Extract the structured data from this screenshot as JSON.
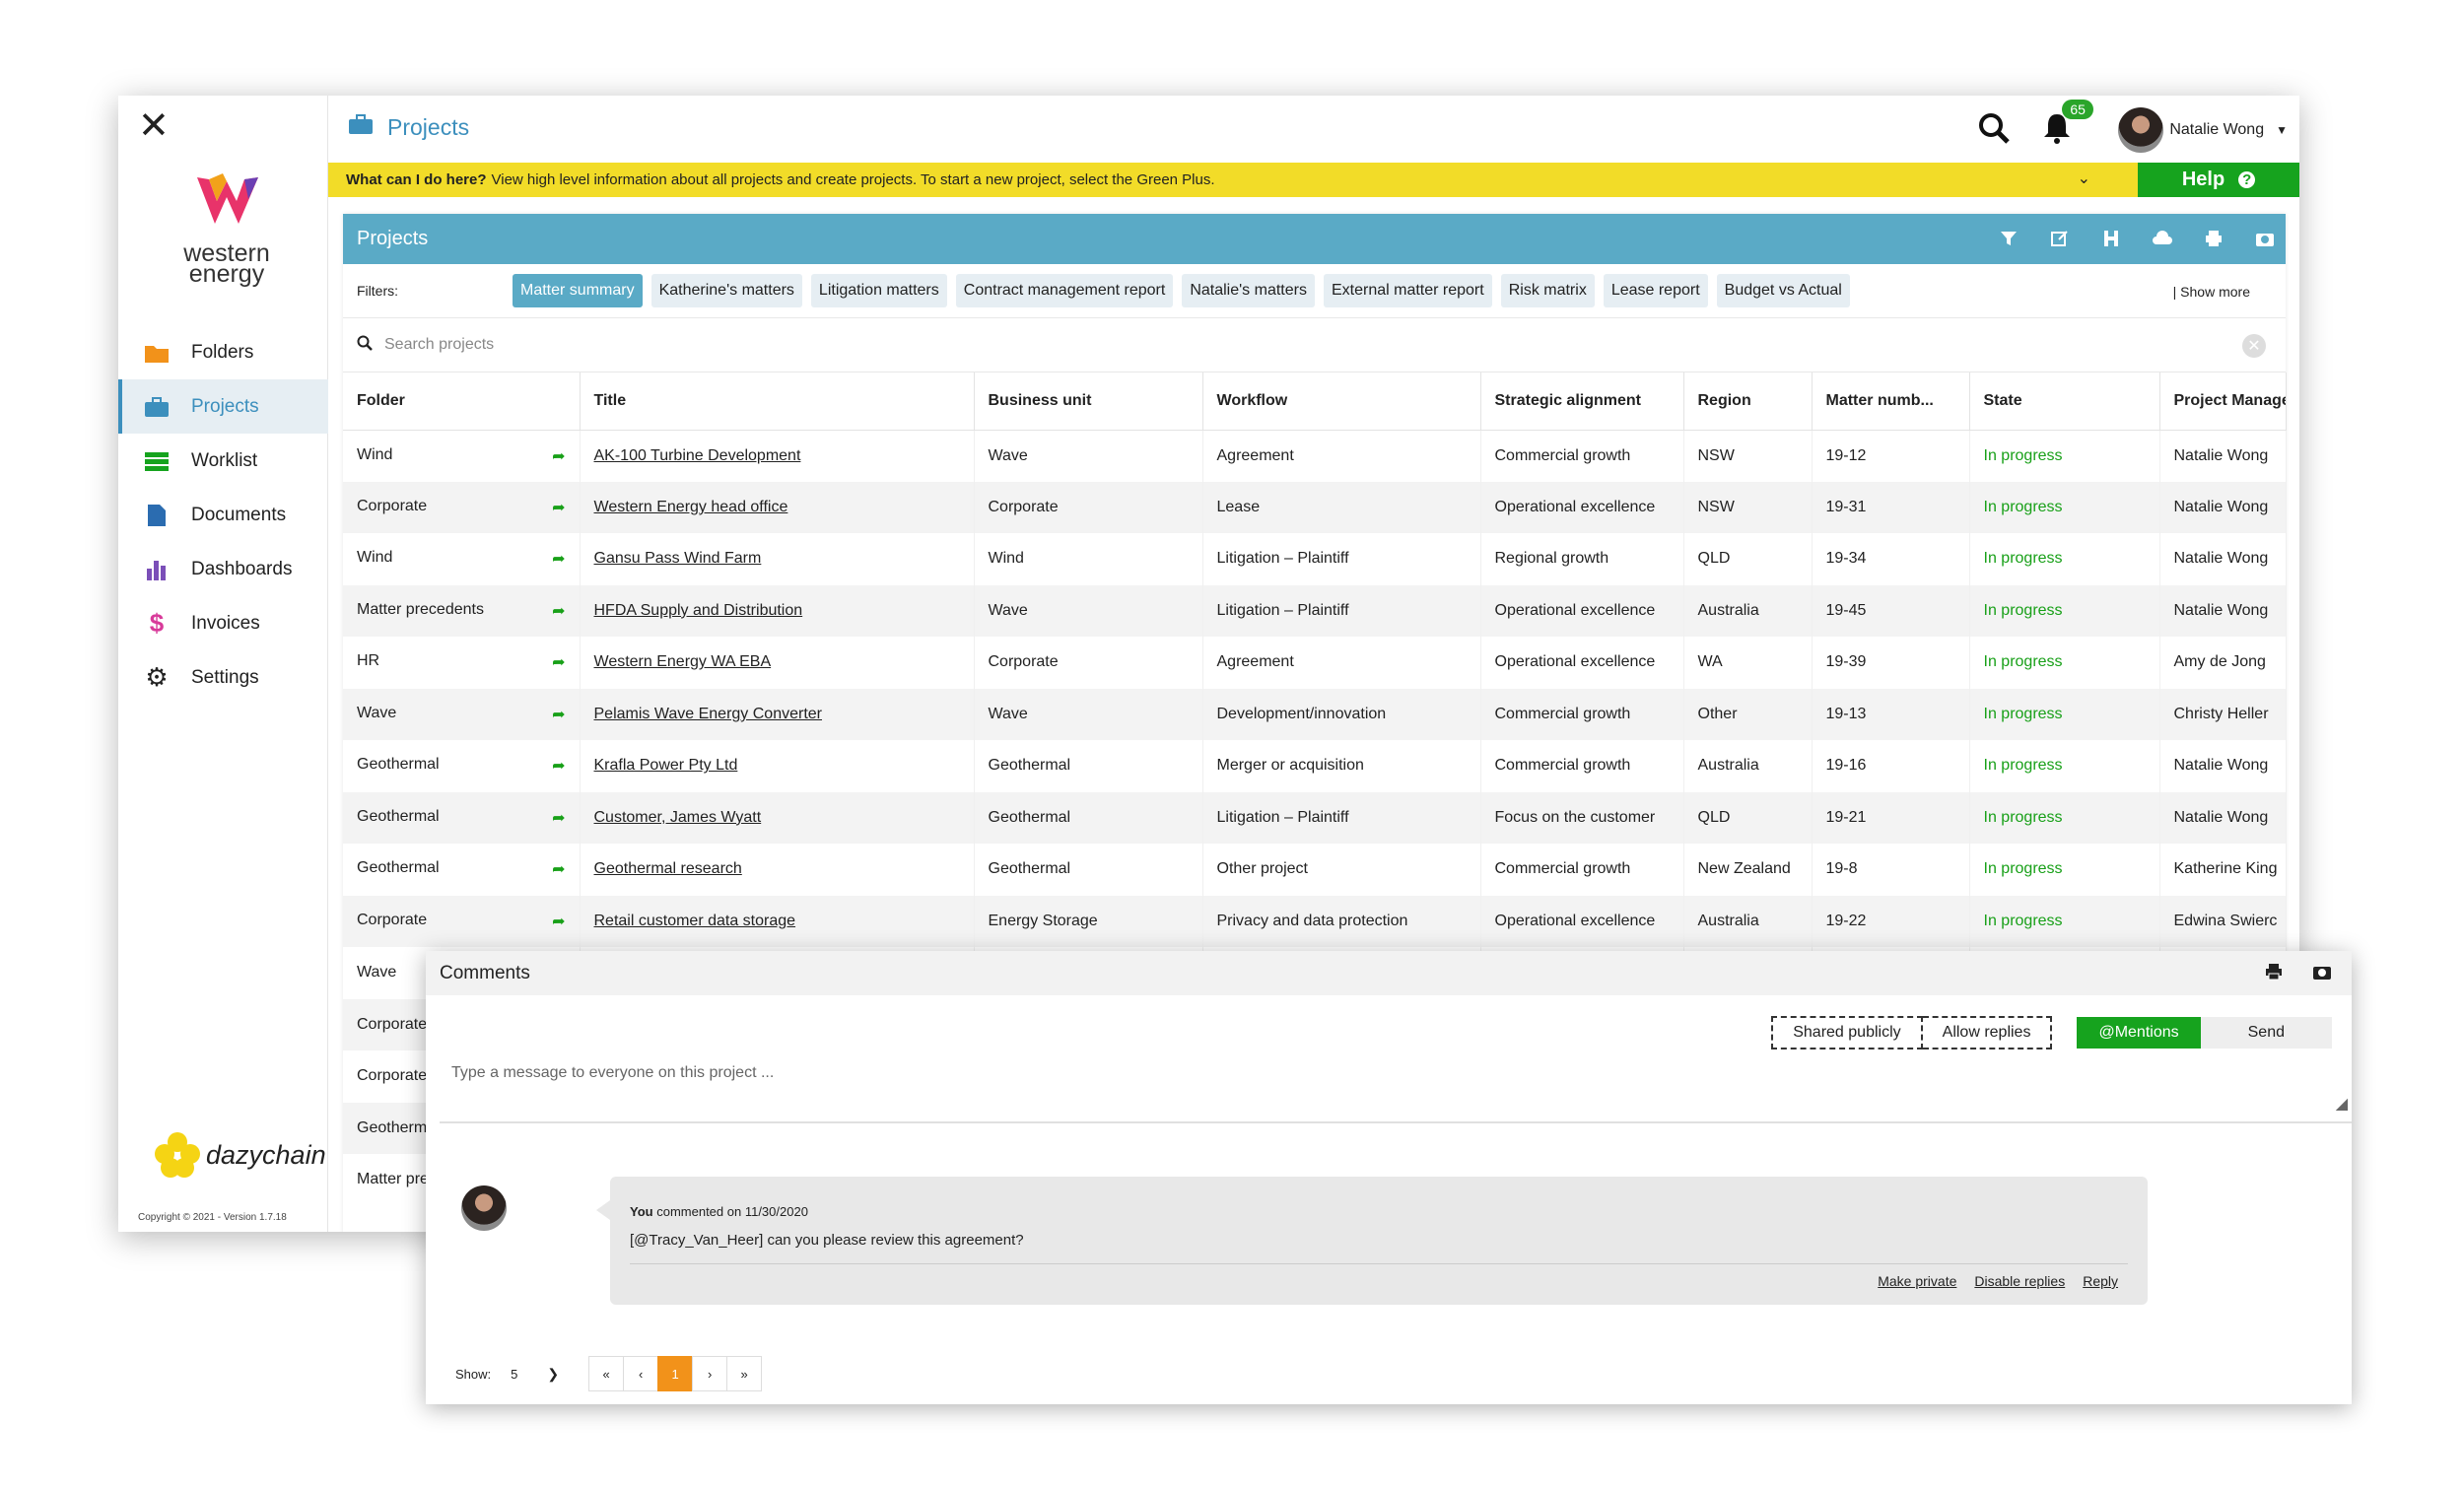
{
  "sidebar": {
    "brand_lines": [
      "western",
      "energy"
    ],
    "items": [
      {
        "label": "Folders",
        "icon": "folder-icon",
        "color": "#f2921a"
      },
      {
        "label": "Projects",
        "icon": "briefcase-icon",
        "color": "#3c8fbd",
        "active": true
      },
      {
        "label": "Worklist",
        "icon": "list-icon",
        "color": "#16a31e"
      },
      {
        "label": "Documents",
        "icon": "document-icon",
        "color": "#2b6cb0"
      },
      {
        "label": "Dashboards",
        "icon": "bar-chart-icon",
        "color": "#7b4fb8"
      },
      {
        "label": "Invoices",
        "icon": "dollar-icon",
        "color": "#d83a9a"
      },
      {
        "label": "Settings",
        "icon": "gear-icon",
        "color": "#222"
      }
    ],
    "partner_brand": "dazychain",
    "copyright": "Copyright © 2021 - Version 1.7.18"
  },
  "topbar": {
    "title": "Projects",
    "notifications": "65",
    "user_name": "Natalie Wong"
  },
  "helpbar": {
    "question": "What can I do here?",
    "text": "View high level information about all projects and create projects. To start a new project, select the Green Plus.",
    "help_label": "Help"
  },
  "panel": {
    "title": "Projects",
    "filters_label": "Filters:",
    "filters": [
      "Matter summary",
      "Katherine's matters",
      "Litigation matters",
      "Contract management report",
      "Natalie's matters",
      "External matter report",
      "Risk matrix",
      "Lease report",
      "Budget vs Actual"
    ],
    "show_more": "| Show more",
    "search_placeholder": "Search projects"
  },
  "table": {
    "columns": [
      "Folder",
      "Title",
      "Business unit",
      "Workflow",
      "Strategic alignment",
      "Region",
      "Matter numb...",
      "State",
      "Project Manage"
    ],
    "rows": [
      [
        "Wind",
        "AK-100 Turbine Development",
        "Wave",
        "Agreement",
        "Commercial growth",
        "NSW",
        "19-12",
        "In progress",
        "Natalie Wong"
      ],
      [
        "Corporate",
        "Western Energy head office",
        "Corporate",
        "Lease",
        "Operational excellence",
        "NSW",
        "19-31",
        "In progress",
        "Natalie Wong"
      ],
      [
        "Wind",
        "Gansu Pass Wind Farm",
        "Wind",
        "Litigation – Plaintiff",
        "Regional growth",
        "QLD",
        "19-34",
        "In progress",
        "Natalie Wong"
      ],
      [
        "Matter precedents",
        "HFDA Supply and Distribution",
        "Wave",
        "Litigation – Plaintiff",
        "Operational excellence",
        "Australia",
        "19-45",
        "In progress",
        "Natalie Wong"
      ],
      [
        "HR",
        "Western Energy WA EBA",
        "Corporate",
        "Agreement",
        "Operational excellence",
        "WA",
        "19-39",
        "In progress",
        "Amy de Jong"
      ],
      [
        "Wave",
        "Pelamis Wave Energy Converter",
        "Wave",
        "Development/innovation",
        "Commercial growth",
        "Other",
        "19-13",
        "In progress",
        "Christy Heller"
      ],
      [
        "Geothermal",
        "Krafla Power Pty Ltd",
        "Geothermal",
        "Merger or acquisition",
        "Commercial growth",
        "Australia",
        "19-16",
        "In progress",
        "Natalie Wong"
      ],
      [
        "Geothermal",
        "Customer, James Wyatt",
        "Geothermal",
        "Litigation – Plaintiff",
        "Focus on the customer",
        "QLD",
        "19-21",
        "In progress",
        "Natalie Wong"
      ],
      [
        "Geothermal",
        "Geothermal research",
        "Geothermal",
        "Other project",
        "Commercial growth",
        "New Zealand",
        "19-8",
        "In progress",
        "Katherine King"
      ],
      [
        "Corporate",
        "Retail customer data storage",
        "Energy Storage",
        "Privacy and data protection",
        "Operational excellence",
        "Australia",
        "19-22",
        "In progress",
        "Edwina Swierc"
      ],
      [
        "Wave",
        "",
        "",
        "",
        "",
        "",
        "",
        "",
        ""
      ],
      [
        "Corporate",
        "",
        "",
        "",
        "",
        "",
        "",
        "",
        ""
      ],
      [
        "Corporate",
        "",
        "",
        "",
        "",
        "",
        "",
        "",
        ""
      ],
      [
        "Geotherm",
        "",
        "",
        "",
        "",
        "",
        "",
        "",
        ""
      ],
      [
        "Matter pre",
        "",
        "",
        "",
        "",
        "",
        "",
        "",
        ""
      ]
    ]
  },
  "comments": {
    "title": "Comments",
    "shared_label": "Shared publicly",
    "replies_label": "Allow replies",
    "mentions_label": "@Mentions",
    "send_label": "Send",
    "placeholder": "Type a message to everyone on this project ...",
    "entry": {
      "author": "You",
      "meta": "commented on 11/30/2020",
      "text": "[@Tracy_Van_Heer] can you please review this agreement?",
      "actions": [
        "Make private",
        "Disable replies",
        "Reply"
      ]
    },
    "show_label": "Show:",
    "show_value": "5",
    "pager": [
      "«",
      "‹",
      "1",
      "›",
      "»"
    ]
  },
  "colors": {
    "accent": "#5aaac6",
    "nav_active": "#3c8fbd",
    "green": "#16a31e",
    "help_yellow": "#f2dc28",
    "pager_active": "#f2921a"
  }
}
